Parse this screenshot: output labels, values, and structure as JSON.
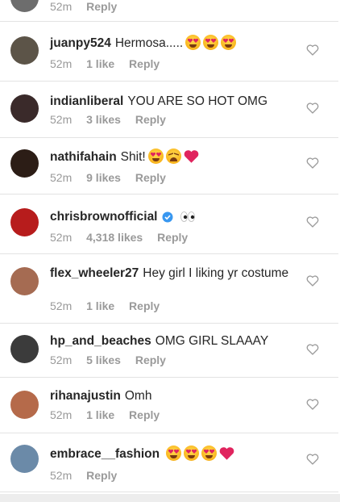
{
  "comments": [
    {
      "username": "",
      "text": "",
      "time": "52m",
      "likes": "",
      "reply": "Reply",
      "avatar_color": "#6d6d6d"
    },
    {
      "username": "juanpy524",
      "text": "Hermosa.....",
      "emojis": [
        "heart-eyes-emoji",
        "heart-eyes-emoji",
        "heart-eyes-emoji"
      ],
      "time": "52m",
      "likes": "1 like",
      "reply": "Reply",
      "avatar_color": "#5c5448"
    },
    {
      "username": "indianliberal",
      "text": "YOU ARE SO HOT OMG",
      "time": "52m",
      "likes": "3 likes",
      "reply": "Reply",
      "avatar_color": "#3a2a2a"
    },
    {
      "username": "nathifahain",
      "text": "Shit!",
      "emojis": [
        "heart-eyes-emoji",
        "weary-face-emoji",
        "red-heart-emoji"
      ],
      "time": "52m",
      "likes": "9 likes",
      "reply": "Reply",
      "avatar_color": "#2c1d16"
    },
    {
      "username": "chrisbrownofficial",
      "text": "",
      "emojis": [
        "eyes-emoji"
      ],
      "verified": true,
      "time": "52m",
      "likes": "4,318 likes",
      "reply": "Reply",
      "avatar_color": "#b71c1c"
    },
    {
      "username": "flex_wheeler27",
      "text": "Hey girl I liking yr costume",
      "time": "52m",
      "likes": "1 like",
      "reply": "Reply",
      "avatar_color": "#a56b52"
    },
    {
      "username": "hp_and_beaches",
      "text": "OMG GIRL SLAAAY",
      "time": "52m",
      "likes": "5 likes",
      "reply": "Reply",
      "avatar_color": "#3b3b3b"
    },
    {
      "username": "rihanajustin",
      "text": "Omh",
      "time": "52m",
      "likes": "1 like",
      "reply": "Reply",
      "avatar_color": "#b56a4a"
    },
    {
      "username": "embrace__fashion",
      "text": "",
      "emojis": [
        "heart-eyes-emoji",
        "heart-eyes-emoji",
        "heart-eyes-emoji",
        "red-heart-emoji"
      ],
      "time": "52m",
      "likes": "",
      "reply": "Reply",
      "avatar_color": "#6b8aa8"
    }
  ],
  "colors": {
    "meta_text": "#999999",
    "divider": "#e3e3e3",
    "verified_blue": "#3897f0",
    "heart_red": "#e0245e"
  },
  "icons": {
    "like": "heart-outline-icon"
  }
}
